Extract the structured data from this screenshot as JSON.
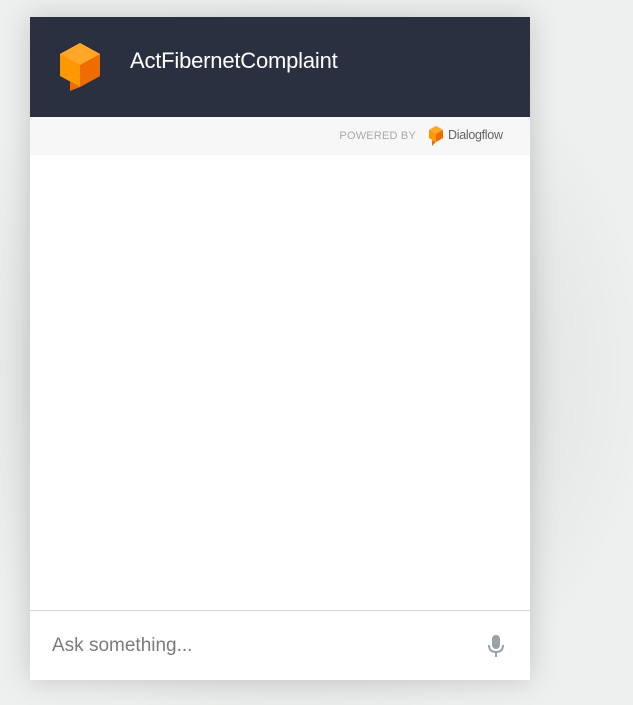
{
  "header": {
    "agent_name": "ActFibernetComplaint"
  },
  "powered": {
    "label": "POWERED BY",
    "brand": "Dialogflow"
  },
  "input": {
    "placeholder": "Ask something...",
    "value": ""
  },
  "icons": {
    "agent_logo": "dialogflow-cube-icon",
    "brand_logo": "dialogflow-cube-icon",
    "mic": "microphone-icon"
  },
  "colors": {
    "header_bg": "#2b3040",
    "logo_orange": "#ff9800",
    "logo_dark_orange": "#ef6c00",
    "powered_bar_bg": "#f7f7f7"
  }
}
